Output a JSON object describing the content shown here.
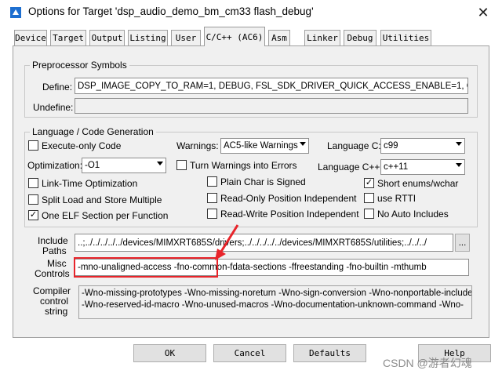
{
  "window": {
    "title": "Options for Target 'dsp_audio_demo_bm_cm33 flash_debug'",
    "close_glyph": "✕"
  },
  "tabs": [
    "Device",
    "Target",
    "Output",
    "Listing",
    "User",
    "C/C++ (AC6)",
    "Asm",
    "Linker",
    "Debug",
    "Utilities"
  ],
  "active_tab": "C/C++ (AC6)",
  "preprocessor": {
    "group_label": "Preprocessor Symbols",
    "define_label": "Define:",
    "define_value": "DSP_IMAGE_COPY_TO_RAM=1, DEBUG, FSL_SDK_DRIVER_QUICK_ACCESS_ENABLE=1, CPU_MI",
    "undefine_label": "Undefine:",
    "undefine_value": ""
  },
  "language": {
    "group_label": "Language / Code Generation",
    "execute_only": {
      "label": "Execute-only Code",
      "checked": false
    },
    "warnings_label": "Warnings:",
    "warnings_value": "AC5-like Warnings",
    "language_c_label": "Language C:",
    "language_c_value": "c99",
    "optimization_label": "Optimization:",
    "optimization_value": "-O1",
    "turn_warnings": {
      "label": "Turn Warnings into Errors",
      "checked": false
    },
    "language_cpp_label": "Language C++:",
    "language_cpp_value": "c++11",
    "link_time": {
      "label": "Link-Time Optimization",
      "checked": false
    },
    "plain_char": {
      "label": "Plain Char is Signed",
      "checked": false
    },
    "short_enums": {
      "label": "Short enums/wchar",
      "checked": true
    },
    "split_load": {
      "label": "Split Load and Store Multiple",
      "checked": false
    },
    "ropi": {
      "label": "Read-Only Position Independent",
      "checked": false
    },
    "use_rtti": {
      "label": "use RTTI",
      "checked": false
    },
    "one_elf": {
      "label": "One ELF Section per Function",
      "checked": true
    },
    "rwpi": {
      "label": "Read-Write Position Independent",
      "checked": false
    },
    "no_auto_includes": {
      "label": "No Auto Includes",
      "checked": false
    },
    "check_glyph": "✓"
  },
  "include": {
    "label_line1": "Include",
    "label_line2": "Paths",
    "value": "..;../../../../../devices/MIMXRT685S/drivers;../../../../../devices/MIMXRT685S/utilities;../../../",
    "browse_label": "..."
  },
  "misc": {
    "label_line1": "Misc",
    "label_line2": "Controls",
    "value_highlighted": "-mno-unaligned-access -fno-common",
    "value_rest": " -fdata-sections -ffreestanding -fno-builtin -mthumb",
    "highlight_color": "#e8242a"
  },
  "compiler": {
    "label_line1": "Compiler",
    "label_line2": "control",
    "label_line3": "string",
    "line1": "-Wno-missing-prototypes -Wno-missing-noreturn -Wno-sign-conversion -Wno-nonportable-include-path",
    "line2": "-Wno-reserved-id-macro -Wno-unused-macros -Wno-documentation-unknown-command -Wno-"
  },
  "buttons": {
    "ok": "OK",
    "cancel": "Cancel",
    "defaults": "Defaults",
    "help": "Help"
  },
  "watermark": "CSDN @游者幻魂"
}
